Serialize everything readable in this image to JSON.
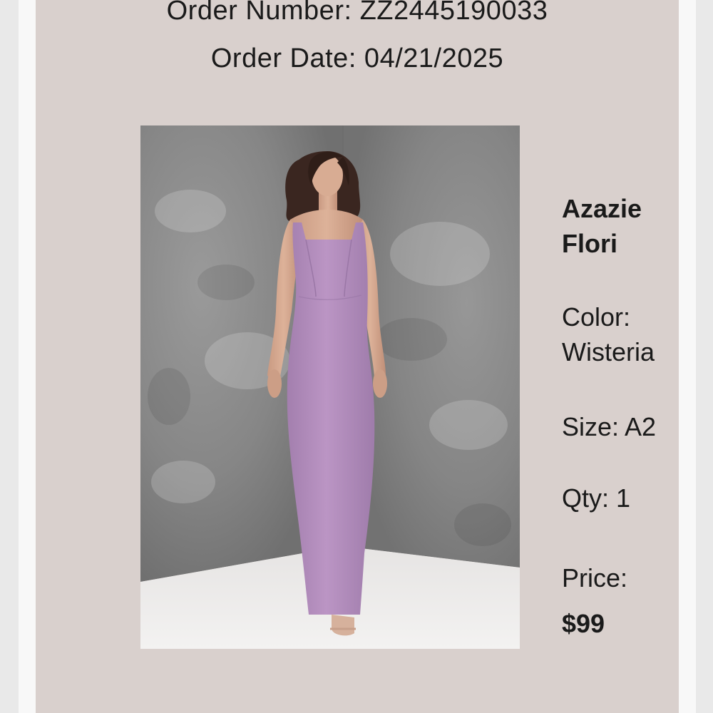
{
  "order": {
    "number_text": "Order Number: ZZ2445190033",
    "date_text": "Order Date: 04/21/2025"
  },
  "product": {
    "name_line1": "Azazie",
    "name_line2": "Flori",
    "color_label": "Color:",
    "color_value": "Wisteria",
    "size_text": "Size: A2",
    "qty_text": "Qty: 1",
    "price_label": "Price:",
    "price_value": "$99"
  },
  "colors": {
    "card_background": "#d9d0cd",
    "dress": "#b68fc0",
    "backdrop": "#8c8c8c",
    "floor": "#ecebea"
  }
}
